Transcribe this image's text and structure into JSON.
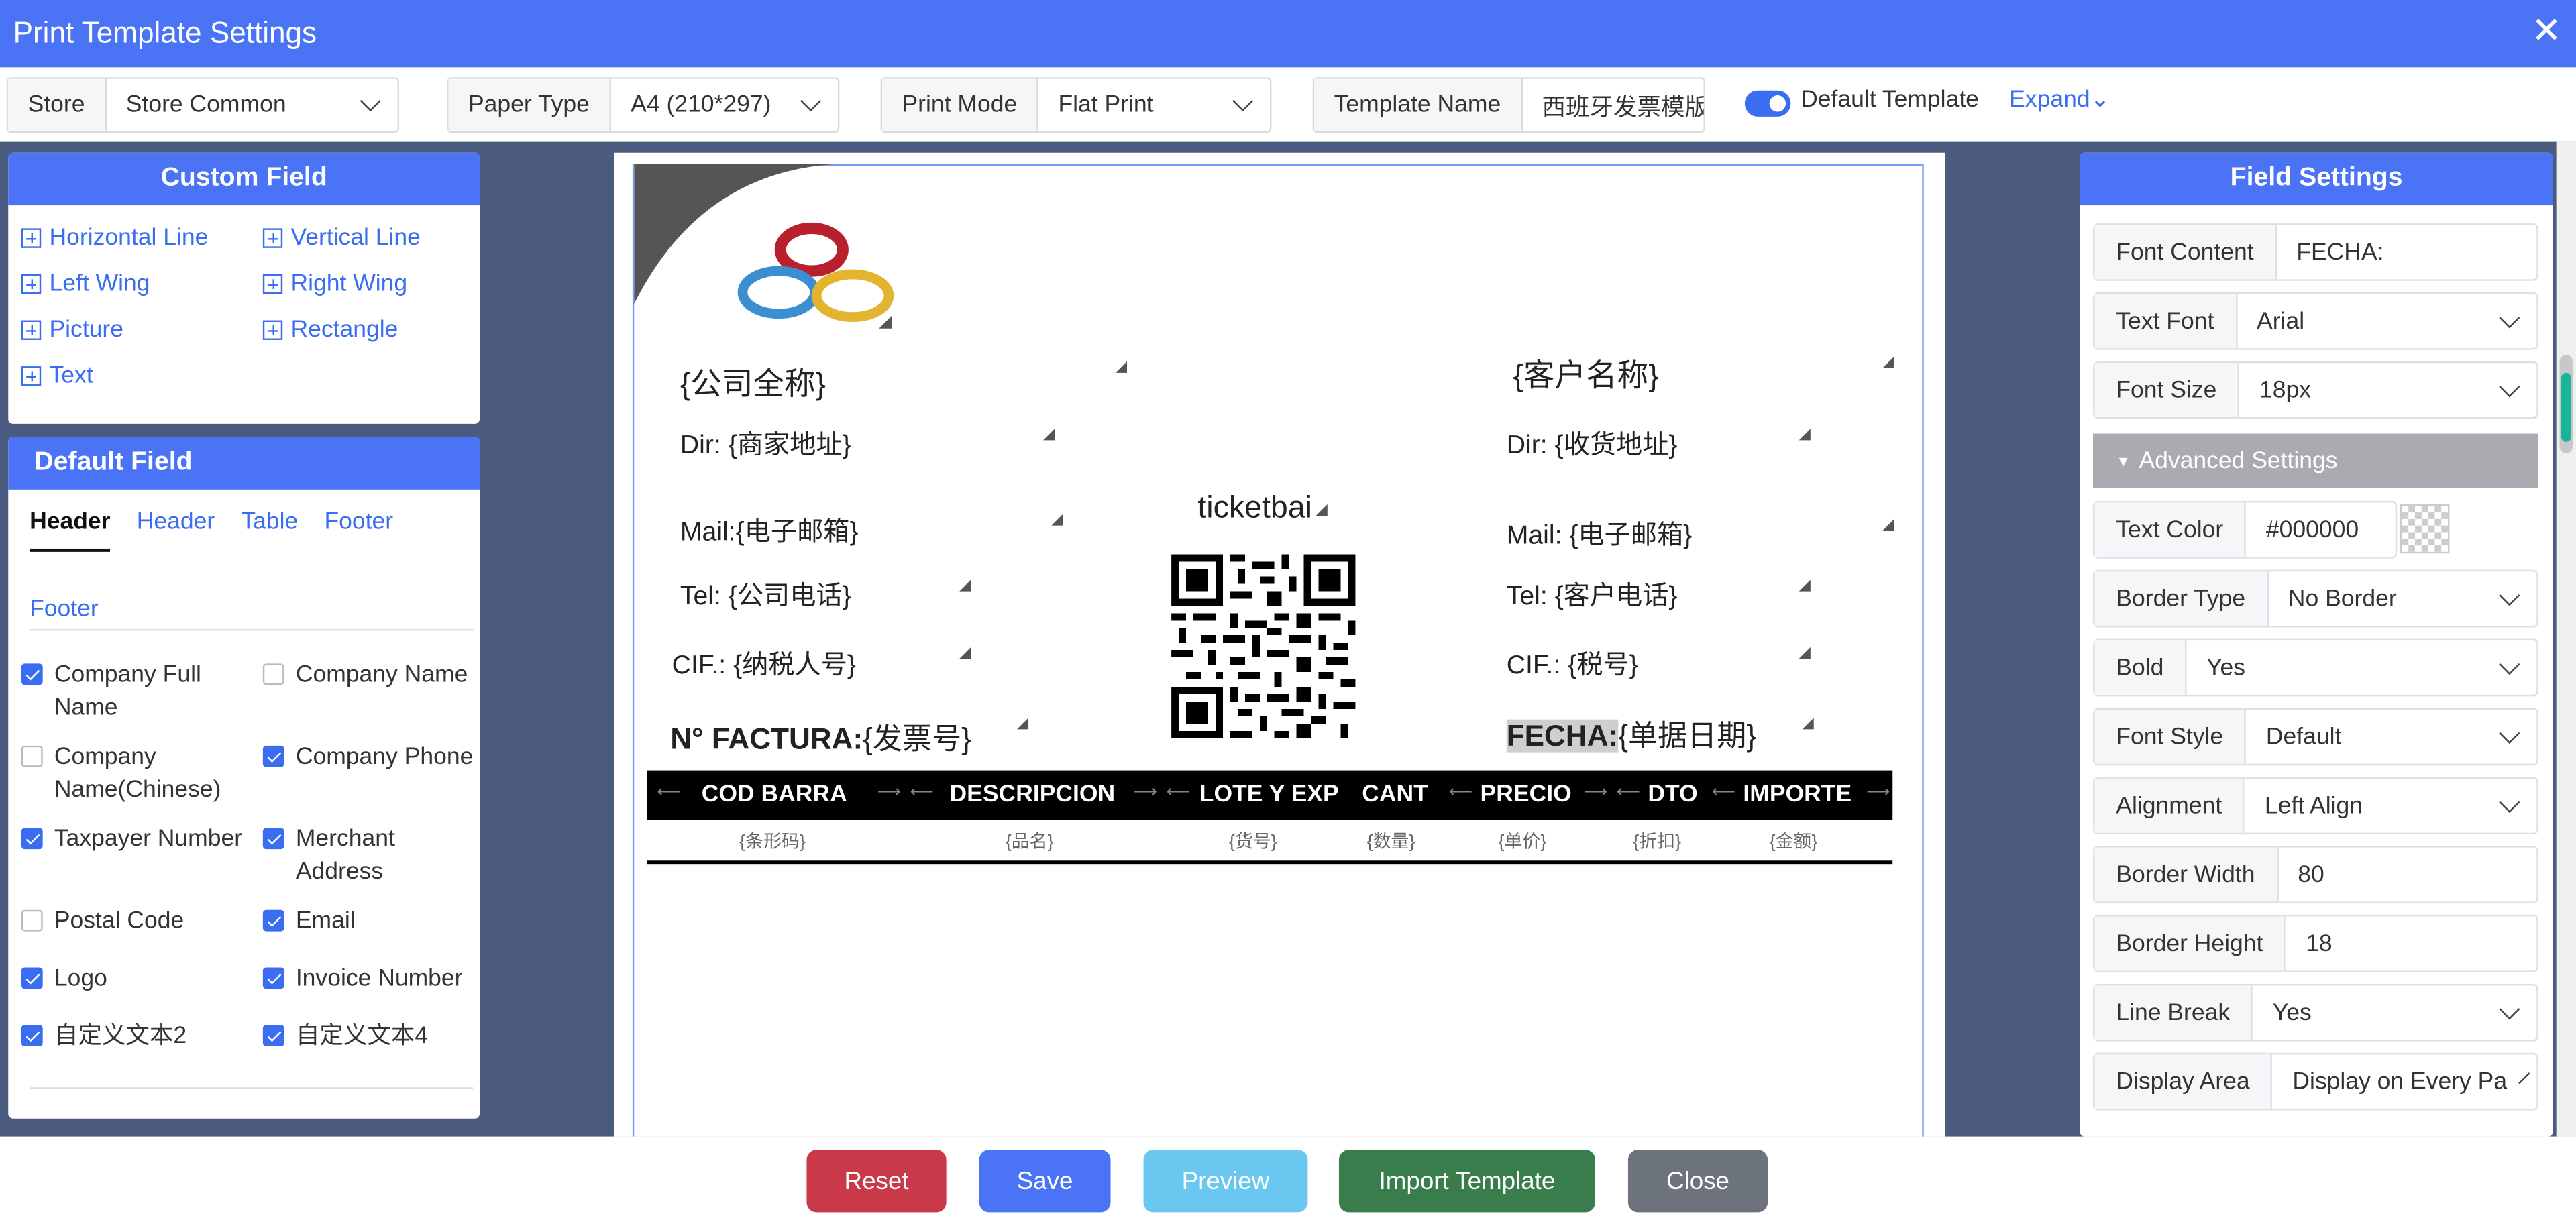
{
  "window": {
    "title": "Print Template Settings",
    "close_icon": "close-icon"
  },
  "toolbar": {
    "store_label": "Store",
    "store_value": "Store Common",
    "paper_label": "Paper Type",
    "paper_value": "A4 (210*297)",
    "mode_label": "Print Mode",
    "mode_value": "Flat Print",
    "tplname_label": "Template Name",
    "tplname_value": "西班牙发票模版",
    "default_template_label": "Default Template",
    "default_template_on": true,
    "expand_label": "Expand"
  },
  "custom_field": {
    "title": "Custom Field",
    "items": [
      "Horizontal Line",
      "Vertical Line",
      "Left Wing",
      "Right Wing",
      "Picture",
      "Rectangle",
      "Text"
    ]
  },
  "default_field": {
    "title": "Default Field",
    "tabs": [
      "Header",
      "Header",
      "Table",
      "Footer"
    ],
    "active_tab": 0,
    "section": "Footer",
    "checks": [
      {
        "label": "Company Full Name",
        "checked": true
      },
      {
        "label": "Company Name",
        "checked": false
      },
      {
        "label": "Company Name(Chinese)",
        "checked": false
      },
      {
        "label": "Company Phone",
        "checked": true
      },
      {
        "label": "Taxpayer Number",
        "checked": true
      },
      {
        "label": "Merchant Address",
        "checked": true
      },
      {
        "label": "Postal Code",
        "checked": false
      },
      {
        "label": "Email",
        "checked": true
      },
      {
        "label": "Logo",
        "checked": true
      },
      {
        "label": "Invoice Number",
        "checked": true
      },
      {
        "label": "自定义文本2",
        "checked": true
      },
      {
        "label": "自定义文本4",
        "checked": true
      }
    ]
  },
  "canvas": {
    "company": "{公司全称}",
    "customer": "{客户名称}",
    "dir_left": "Dir: {商家地址}",
    "dir_right": "Dir: {收货地址}",
    "mail_left": "Mail:{电子邮箱}",
    "mail_right": "Mail: {电子邮箱}",
    "tel_left": "Tel: {公司电话}",
    "tel_right": "Tel: {客户电话}",
    "cif_left": "CIF.: {纳税人号}",
    "cif_right": "CIF.: {税号}",
    "factura_label": "N° FACTURA:",
    "factura_value": "{发票号}",
    "fecha_label": "FECHA:",
    "fecha_value": "{单据日期}",
    "ticketbai": "ticketbai",
    "table_headers": [
      "COD BARRA",
      "DESCRIPCION",
      "LOTE Y EXP",
      "CANT",
      "PRECIO",
      "DTO",
      "IMPORTE"
    ],
    "table_values": [
      "{条形码}",
      "{品名}",
      "{货号}",
      "{数量}",
      "{单价}",
      "{折扣}",
      "{金额}"
    ]
  },
  "field_settings": {
    "title": "Field Settings",
    "font_content_label": "Font Content",
    "font_content_value": "FECHA:",
    "text_font_label": "Text Font",
    "text_font_value": "Arial",
    "font_size_label": "Font Size",
    "font_size_value": "18px",
    "advanced_label": "Advanced Settings",
    "text_color_label": "Text Color",
    "text_color_value": "#000000",
    "border_type_label": "Border Type",
    "border_type_value": "No Border",
    "bold_label": "Bold",
    "bold_value": "Yes",
    "font_style_label": "Font Style",
    "font_style_value": "Default",
    "alignment_label": "Alignment",
    "alignment_value": "Left Align",
    "border_width_label": "Border Width",
    "border_width_value": "80",
    "border_height_label": "Border Height",
    "border_height_value": "18",
    "line_break_label": "Line Break",
    "line_break_value": "Yes",
    "display_area_label": "Display Area",
    "display_area_value": "Display on Every Pa"
  },
  "buttons": {
    "reset": "Reset",
    "save": "Save",
    "preview": "Preview",
    "import": "Import Template",
    "close": "Close"
  },
  "colors": {
    "primary": "#4a74f5",
    "workspace": "#4b5a7f",
    "reset": "#c9394a",
    "save": "#4a74f5",
    "preview": "#6ac7ef",
    "import": "#3a7d4c",
    "close": "#6c737d"
  }
}
